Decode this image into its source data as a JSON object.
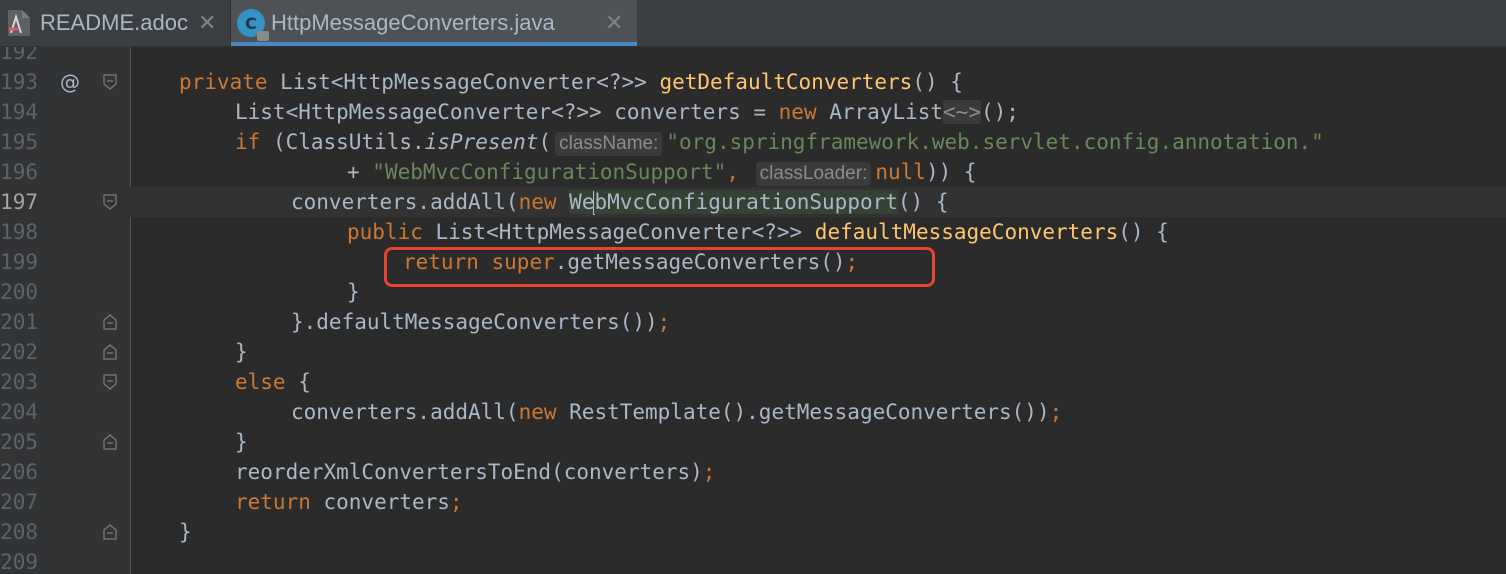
{
  "tabs": [
    {
      "label": "README.adoc",
      "icon": "asciidoc-file-icon",
      "active": false
    },
    {
      "label": "HttpMessageConverters.java",
      "icon": "java-class-icon",
      "active": true
    }
  ],
  "editor": {
    "line_numbers": [
      "192",
      "193",
      "194",
      "195",
      "196",
      "197",
      "198",
      "199",
      "200",
      "201",
      "202",
      "203",
      "204",
      "205",
      "206",
      "207",
      "208",
      "209"
    ],
    "active_line": "197",
    "override_marker": "@",
    "lines": {
      "l193": {
        "kw_private": "private",
        "t1": " List<HttpMessageConverter<?>> ",
        "fn": "getDefaultConverters",
        "t2": "() {"
      },
      "l194": {
        "t1": "List<HttpMessageConverter<?>> converters = ",
        "kw_new": "new",
        "t2": " ArrayList",
        "diamond": "<~>",
        "t3": "();"
      },
      "l195": {
        "kw_if": "if",
        "t1": " (ClassUtils.",
        "fn_italic": "isPresent",
        "t2": "(",
        "hint": "className:",
        "str": "\"org.springframework.web.servlet.config.annotation.\""
      },
      "l196": {
        "t1": "+ ",
        "str": "\"WebMvcConfigurationSupport\"",
        "t2": ",",
        "hint": "classLoader:",
        "kw_null": "null",
        "t3": ")) {"
      },
      "l197": {
        "t1": "converters.addAll(",
        "kw_new": "new",
        "t2": " ",
        "hl_a": "We",
        "hl_b": "bMvcConfigurationSupport",
        "t3": "() {"
      },
      "l198": {
        "kw_public": "public",
        "t1": " List<HttpMessageConverter<?>> ",
        "fn": "defaultMessageConverters",
        "t2": "() {"
      },
      "l199": {
        "kw_return": "return",
        "t1": " ",
        "kw_super": "super",
        "t2": ".getMessageConverters()",
        "semi": ";"
      },
      "l200": {
        "t1": "}"
      },
      "l201": {
        "t1": "}.defaultMessageConverters())",
        "semi": ";"
      },
      "l202": {
        "t1": "}"
      },
      "l203": {
        "kw_else": "else",
        "t1": " {"
      },
      "l204": {
        "t1": "converters.addAll(",
        "kw_new": "new",
        "t2": " RestTemplate().getMessageConverters())",
        "semi": ";"
      },
      "l205": {
        "t1": "}"
      },
      "l206": {
        "t1": "reorderXmlConvertersToEnd(converters)",
        "semi": ";"
      },
      "l207": {
        "kw_return": "return",
        "t1": " converters",
        "semi": ";"
      },
      "l208": {
        "t1": "}"
      }
    }
  },
  "colors": {
    "background": "#2b2b2b",
    "keyword": "#cc7832",
    "method": "#ffc66d",
    "string": "#6a8759",
    "highlight_box": "#e8452e",
    "tab_underline": "#4a88c7"
  }
}
